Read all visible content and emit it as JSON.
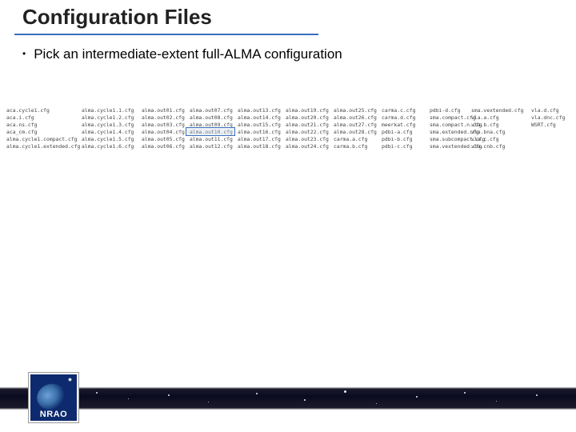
{
  "title": "Configuration Files",
  "bullet": "Pick an intermediate-extent full-ALMA configuration",
  "highlighted_file": "alma.out10.cfg",
  "logo_text": "NRAO",
  "columns": [
    [
      "aca.cycle1.cfg",
      "aca.i.cfg",
      "aca.ns.cfg",
      "aca_cm.cfg",
      "alma.cycle1.compact.cfg",
      "alma.cycle1.extended.cfg"
    ],
    [
      "alma.cycle1.1.cfg",
      "alma.cycle1.2.cfg",
      "alma.cycle1.3.cfg",
      "alma.cycle1.4.cfg",
      "alma.cycle1.5.cfg",
      "alma.cycle1.6.cfg"
    ],
    [
      "alma.out01.cfg",
      "alma.out02.cfg",
      "alma.out03.cfg",
      "alma.out04.cfg",
      "alma.out05.cfg",
      "alma.out06.cfg"
    ],
    [
      "alma.out07.cfg",
      "alma.out08.cfg",
      "alma.out09.cfg",
      "alma.out10.cfg",
      "alma.out11.cfg",
      "alma.out12.cfg"
    ],
    [
      "alma.out13.cfg",
      "alma.out14.cfg",
      "alma.out15.cfg",
      "alma.out16.cfg",
      "alma.out17.cfg",
      "alma.out18.cfg"
    ],
    [
      "alma.out19.cfg",
      "alma.out20.cfg",
      "alma.out21.cfg",
      "alma.out22.cfg",
      "alma.out23.cfg",
      "alma.out24.cfg"
    ],
    [
      "alma.out25.cfg",
      "alma.out26.cfg",
      "alma.out27.cfg",
      "alma.out28.cfg",
      "carma.a.cfg",
      "carma.b.cfg"
    ],
    [
      "carma.c.cfg",
      "carma.d.cfg",
      "meerkat.cfg",
      "pdbi-a.cfg",
      "pdbi-b.cfg",
      "pdbi-c.cfg"
    ],
    [
      "pdbi-d.cfg",
      "sma.compact.cfg",
      "sma.compact.n.cfg",
      "sma.extended.cfg",
      "sma.subcompact.cfg",
      "sma.vextended.cfg"
    ],
    [
      "sma.vextended.cfg",
      "vla.a.cfg",
      "vla.b.cfg",
      "vla.bna.cfg",
      "vla.c.cfg",
      "vla.cnb.cfg"
    ],
    [
      "vla.d.cfg",
      "vla.dnc.cfg",
      "WSRT.cfg",
      "",
      "",
      ""
    ]
  ]
}
